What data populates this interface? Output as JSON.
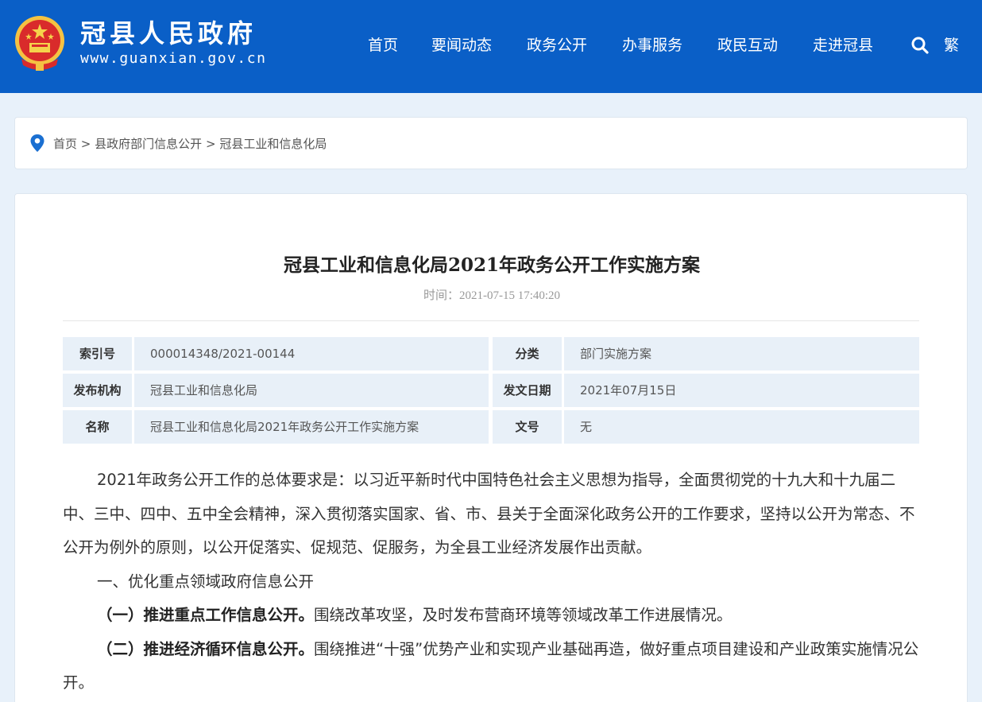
{
  "header": {
    "site_title": "冠县人民政府",
    "site_url": "www.guanxian.gov.cn",
    "nav": [
      "首页",
      "要闻动态",
      "政务公开",
      "办事服务",
      "政民互动",
      "走进冠县"
    ],
    "traditional_label": "繁",
    "bg_color": "#0a5fc7"
  },
  "breadcrumb": {
    "items": [
      "首页",
      "县政府部门信息公开",
      "冠县工业和信息化局"
    ],
    "separator": ">"
  },
  "article": {
    "title": "冠县工业和信息化局2021年政务公开工作实施方案",
    "time_label": "时间：",
    "time_value": "2021-07-15 17:40:20",
    "meta": [
      {
        "label1": "索引号",
        "value1": "000014348/2021-00144",
        "label2": "分类",
        "value2": "部门实施方案"
      },
      {
        "label1": "发布机构",
        "value1": "冠县工业和信息化局",
        "label2": "发文日期",
        "value2": "2021年07月15日"
      },
      {
        "label1": "名称",
        "value1": "冠县工业和信息化局2021年政务公开工作实施方案",
        "label2": "文号",
        "value2": "无"
      }
    ],
    "p1": "2021年政务公开工作的总体要求是：以习近平新时代中国特色社会主义思想为指导，全面贯彻党的十九大和十九届二中、三中、四中、五中全会精神，深入贯彻落实国家、省、市、县关于全面深化政务公开的工作要求，坚持以公开为常态、不公开为例外的原则，以公开促落实、促规范、促服务，为全县工业经济发展作出贡献。",
    "h1": "一、优化重点领域政府信息公开",
    "p2_bold": "（一）推进重点工作信息公开。",
    "p2_text": "围绕改革攻坚，及时发布营商环境等领域改革工作进展情况。",
    "p3_bold": "（二）推进经济循环信息公开。",
    "p3_text": "围绕推进“十强”优势产业和实现产业基础再造，做好重点项目建设和产业政策实施情况公开。"
  }
}
